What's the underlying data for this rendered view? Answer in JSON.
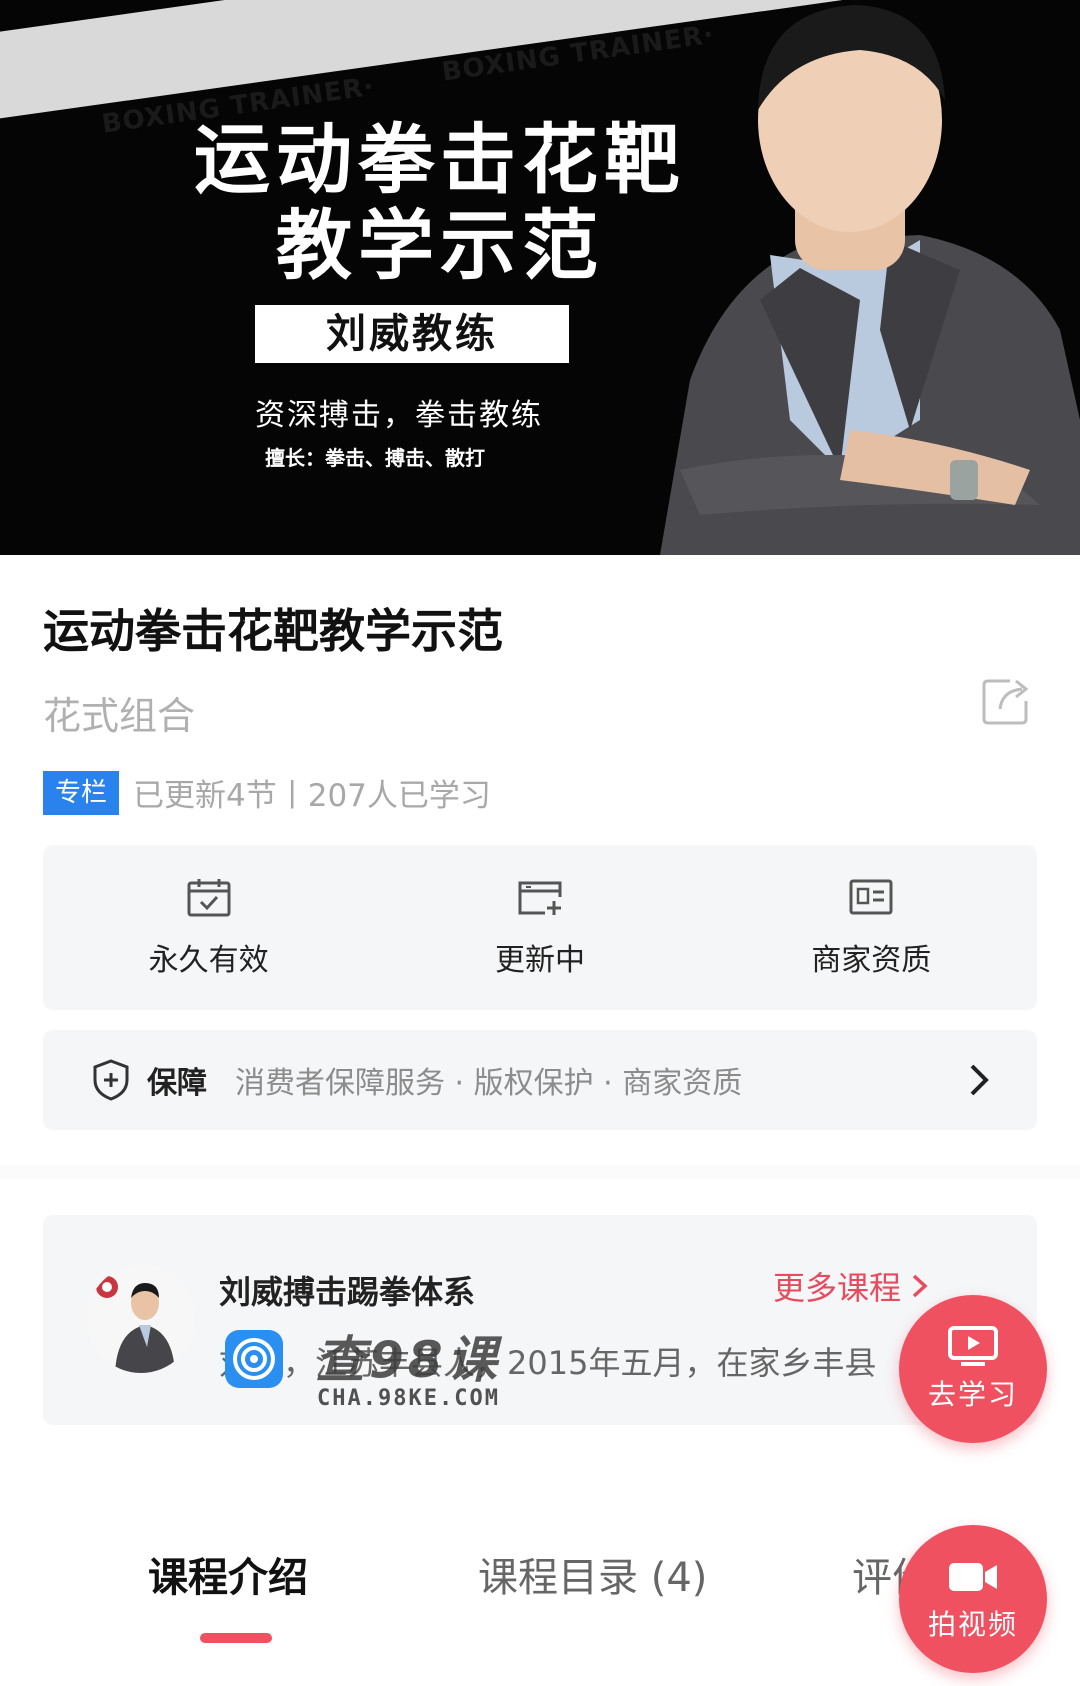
{
  "banner": {
    "stripe_text": "BOXING TRAINER·",
    "title_line1": "运动拳击花靶",
    "title_line2": "教学示范",
    "coach": "刘威教练",
    "subtitle": "资深搏击，拳击教练",
    "skills": "擅长：拳击、搏击、散打"
  },
  "course": {
    "title": "运动拳击花靶教学示范",
    "subtitle": "花式组合",
    "tag": "专栏",
    "meta": "已更新4节丨207人已学习"
  },
  "features": [
    {
      "label": "永久有效",
      "icon": "calendar-check-icon"
    },
    {
      "label": "更新中",
      "icon": "card-add-icon"
    },
    {
      "label": "商家资质",
      "icon": "id-card-icon"
    }
  ],
  "guarantee": {
    "title": "保障",
    "text": "消费者保障服务 · 版权保护 · 商家资质"
  },
  "teacher": {
    "name": "刘威搏击踢拳体系",
    "desc": "刘威，江苏丰县人，2015年五月，在家乡丰县",
    "more": "更多课程"
  },
  "watermark": {
    "text": "查98课",
    "url": "CHA.98KE.COM"
  },
  "fabs": {
    "study": "去学习",
    "shoot": "拍视频"
  },
  "tabs": [
    {
      "label": "课程介绍"
    },
    {
      "label": "课程目录 (4)"
    },
    {
      "label": "评价"
    }
  ],
  "colors": {
    "accent": "#ef5161",
    "tag_blue": "#2a82ee",
    "card_bg": "#f5f6f8"
  }
}
